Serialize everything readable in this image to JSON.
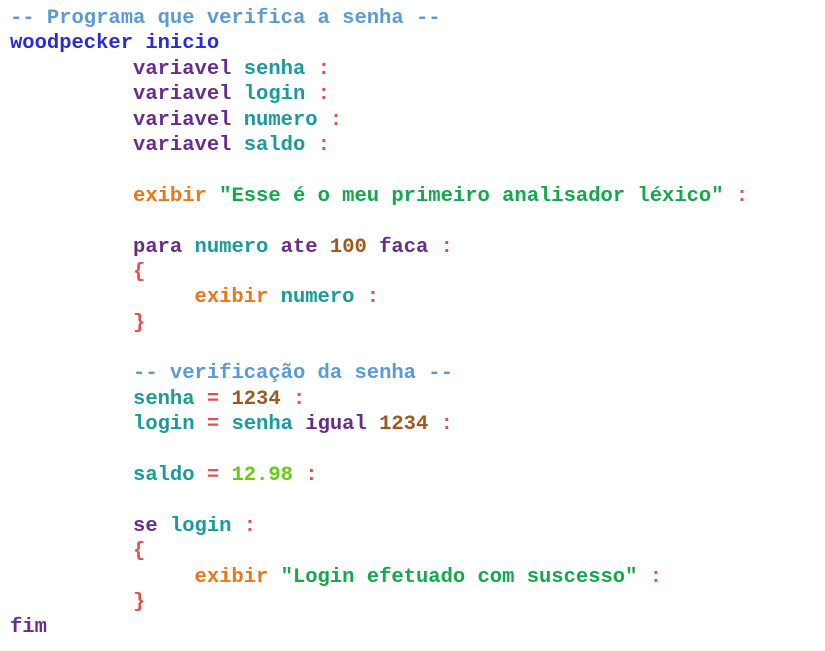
{
  "colors": {
    "comment": "#5a9bd5",
    "keyword": "#6a2c8a",
    "block": "#2b2bd6",
    "identifier": "#1a9a9a",
    "punct": "#e05050",
    "output": "#e8761a",
    "string": "#14a84a",
    "integer": "#9a5a22",
    "float": "#66cc11"
  },
  "code": {
    "lines": [
      [
        {
          "t": "-- Programa que verifica a senha --",
          "c": "comment"
        }
      ],
      [
        {
          "t": "woodpecker inicio",
          "c": "block"
        }
      ],
      [
        {
          "t": "          ",
          "c": "plain"
        },
        {
          "t": "variavel ",
          "c": "keyword"
        },
        {
          "t": "senha ",
          "c": "identifier"
        },
        {
          "t": ":",
          "c": "punct"
        }
      ],
      [
        {
          "t": "          ",
          "c": "plain"
        },
        {
          "t": "variavel ",
          "c": "keyword"
        },
        {
          "t": "login ",
          "c": "identifier"
        },
        {
          "t": ":",
          "c": "punct"
        }
      ],
      [
        {
          "t": "          ",
          "c": "plain"
        },
        {
          "t": "variavel ",
          "c": "keyword"
        },
        {
          "t": "numero ",
          "c": "identifier"
        },
        {
          "t": ":",
          "c": "punct"
        }
      ],
      [
        {
          "t": "          ",
          "c": "plain"
        },
        {
          "t": "variavel ",
          "c": "keyword"
        },
        {
          "t": "saldo ",
          "c": "identifier"
        },
        {
          "t": ":",
          "c": "punct"
        }
      ],
      [],
      [
        {
          "t": "          ",
          "c": "plain"
        },
        {
          "t": "exibir ",
          "c": "output"
        },
        {
          "t": "\"Esse é o meu primeiro analisador léxico\" ",
          "c": "string"
        },
        {
          "t": ":",
          "c": "punct"
        }
      ],
      [],
      [
        {
          "t": "          ",
          "c": "plain"
        },
        {
          "t": "para ",
          "c": "keyword"
        },
        {
          "t": "numero ",
          "c": "identifier"
        },
        {
          "t": "ate ",
          "c": "keyword"
        },
        {
          "t": "100 ",
          "c": "integer"
        },
        {
          "t": "faca ",
          "c": "keyword"
        },
        {
          "t": ":",
          "c": "punct"
        }
      ],
      [
        {
          "t": "          ",
          "c": "plain"
        },
        {
          "t": "{",
          "c": "punct"
        }
      ],
      [
        {
          "t": "               ",
          "c": "plain"
        },
        {
          "t": "exibir ",
          "c": "output"
        },
        {
          "t": "numero ",
          "c": "identifier"
        },
        {
          "t": ":",
          "c": "punct"
        }
      ],
      [
        {
          "t": "          ",
          "c": "plain"
        },
        {
          "t": "}",
          "c": "punct"
        }
      ],
      [],
      [
        {
          "t": "          ",
          "c": "plain"
        },
        {
          "t": "-- verificação da senha --",
          "c": "comment"
        }
      ],
      [
        {
          "t": "          ",
          "c": "plain"
        },
        {
          "t": "senha ",
          "c": "identifier"
        },
        {
          "t": "= ",
          "c": "punct"
        },
        {
          "t": "1234 ",
          "c": "integer"
        },
        {
          "t": ":",
          "c": "punct"
        }
      ],
      [
        {
          "t": "          ",
          "c": "plain"
        },
        {
          "t": "login ",
          "c": "identifier"
        },
        {
          "t": "= ",
          "c": "punct"
        },
        {
          "t": "senha ",
          "c": "identifier"
        },
        {
          "t": "igual ",
          "c": "keyword"
        },
        {
          "t": "1234 ",
          "c": "integer"
        },
        {
          "t": ":",
          "c": "punct"
        }
      ],
      [],
      [
        {
          "t": "          ",
          "c": "plain"
        },
        {
          "t": "saldo ",
          "c": "identifier"
        },
        {
          "t": "= ",
          "c": "punct"
        },
        {
          "t": "12.98 ",
          "c": "float"
        },
        {
          "t": ":",
          "c": "punct"
        }
      ],
      [],
      [
        {
          "t": "          ",
          "c": "plain"
        },
        {
          "t": "se ",
          "c": "keyword"
        },
        {
          "t": "login ",
          "c": "identifier"
        },
        {
          "t": ":",
          "c": "punct"
        }
      ],
      [
        {
          "t": "          ",
          "c": "plain"
        },
        {
          "t": "{",
          "c": "punct"
        }
      ],
      [
        {
          "t": "               ",
          "c": "plain"
        },
        {
          "t": "exibir ",
          "c": "output"
        },
        {
          "t": "\"Login efetuado com suscesso\" ",
          "c": "string"
        },
        {
          "t": ":",
          "c": "punct"
        }
      ],
      [
        {
          "t": "          ",
          "c": "plain"
        },
        {
          "t": "}",
          "c": "punct"
        }
      ],
      [
        {
          "t": "fim",
          "c": "keyword"
        }
      ]
    ]
  }
}
